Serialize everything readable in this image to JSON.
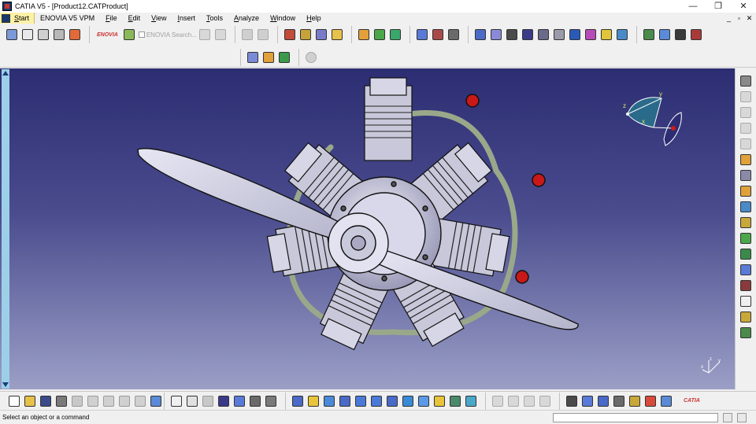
{
  "window": {
    "title": "CATIA V5 - [Product12.CATProduct]",
    "min": "—",
    "restore": "❐",
    "close": "✕"
  },
  "menu": {
    "start": "Start",
    "items": [
      "ENOVIA V5 VPM",
      "File",
      "Edit",
      "View",
      "Insert",
      "Tools",
      "Analyze",
      "Window",
      "Help"
    ],
    "mdi": [
      "_",
      "▫",
      "✕"
    ]
  },
  "toolbar": {
    "enovia_logo": "ENOVIA",
    "enovia_search": "ENOVIA Search..."
  },
  "compass": {
    "x": "x",
    "y": "y",
    "z": "z"
  },
  "corner_axis": {
    "x": "x",
    "y": "y",
    "z": "z"
  },
  "status": {
    "message": "Select an object or a command",
    "command_value": ""
  },
  "catia_logo": "CATIA",
  "colors": {
    "viewport_top": "#2c2d72",
    "viewport_bottom": "#9b9fc6",
    "part": "#c8c8da",
    "accent_red": "#cc1a1a"
  }
}
